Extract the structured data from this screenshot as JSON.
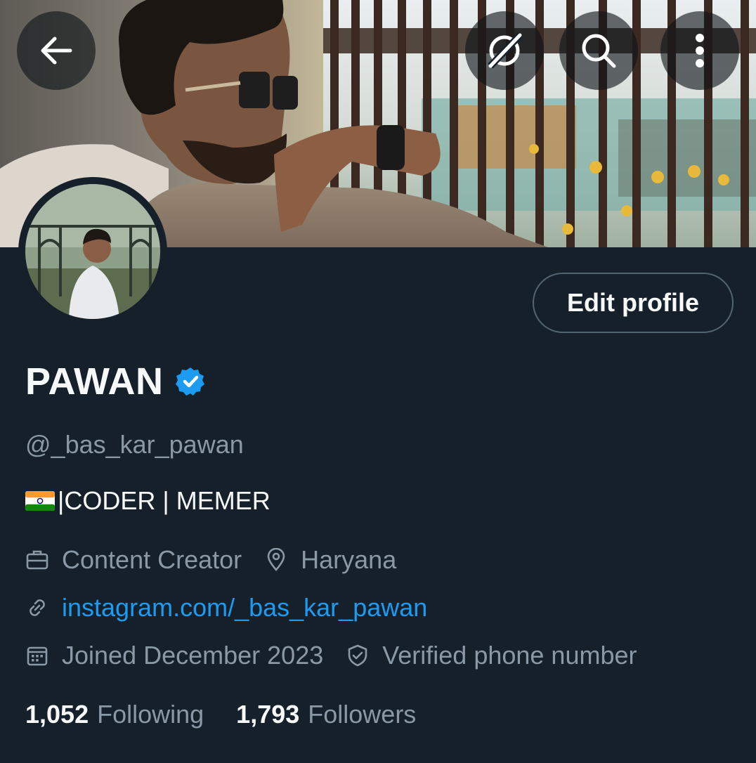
{
  "profile": {
    "name": "PAWAN",
    "handle": "@_bas_kar_pawan",
    "bio_text": "|CODER | MEMER",
    "profession": "Content Creator",
    "location": "Haryana",
    "website": "instagram.com/_bas_kar_pawan",
    "joined": "Joined December 2023",
    "verified_phone": "Verified phone number"
  },
  "actions": {
    "edit_profile_label": "Edit profile"
  },
  "stats": {
    "following_count": "1,052",
    "following_label": "Following",
    "followers_count": "1,793",
    "followers_label": "Followers"
  },
  "icons": {
    "back": "arrow-left-icon",
    "grok": "grok-icon",
    "search": "search-icon",
    "more": "more-vertical-icon",
    "verified": "verified-badge-icon",
    "flag": "india-flag-icon",
    "profession": "briefcase-icon",
    "location": "location-pin-icon",
    "link": "link-icon",
    "calendar": "calendar-icon",
    "shield": "shield-icon"
  },
  "colors": {
    "background": "#15202b",
    "accent": "#1d9bf0",
    "secondary_text": "#8b98a5"
  }
}
